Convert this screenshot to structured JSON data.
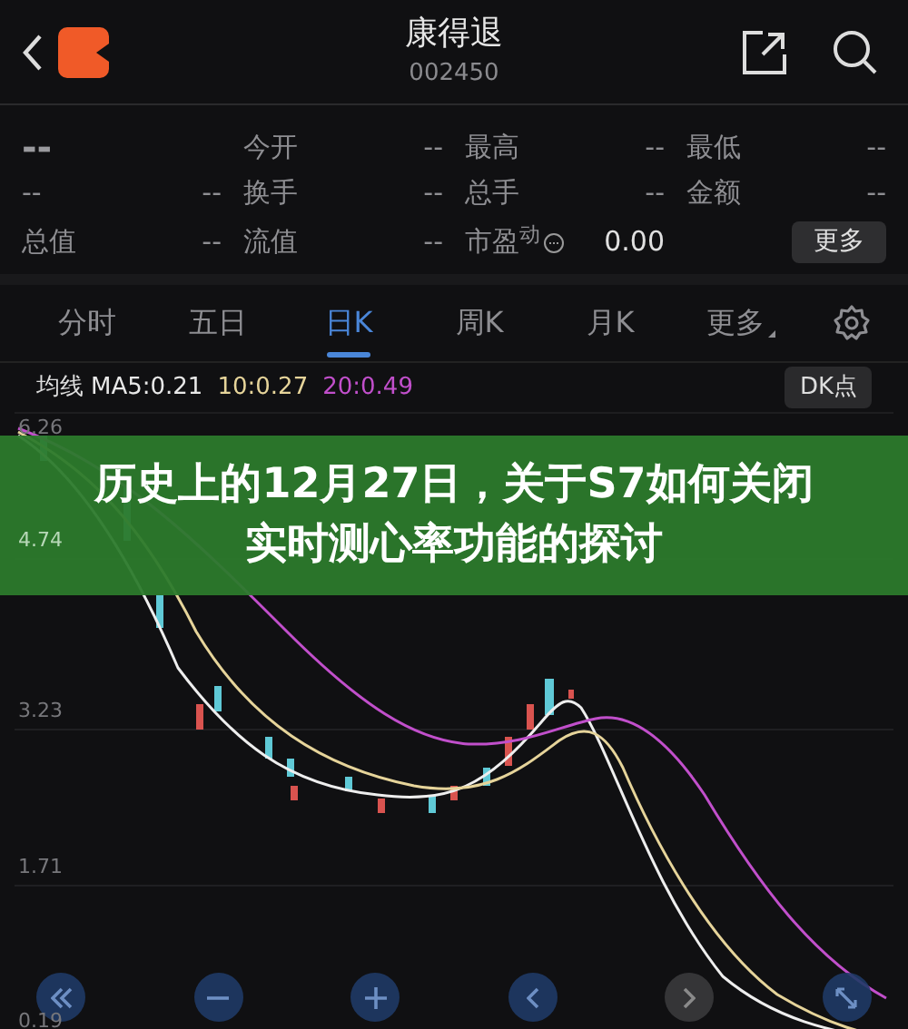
{
  "header": {
    "title": "康得退",
    "code": "002450"
  },
  "quote": {
    "rows": [
      [
        {
          "kind": "price",
          "value": "--"
        },
        {
          "kind": "stat",
          "label": "今开",
          "value": "--"
        },
        {
          "kind": "stat",
          "label": "最高",
          "value": "--"
        },
        {
          "kind": "stat",
          "label": "最低",
          "value": "--"
        }
      ],
      [
        {
          "kind": "stat",
          "label": "--",
          "value": "--"
        },
        {
          "kind": "stat",
          "label": "换手",
          "value": "--"
        },
        {
          "kind": "stat",
          "label": "总手",
          "value": "--"
        },
        {
          "kind": "stat",
          "label": "金额",
          "value": "--"
        }
      ],
      [
        {
          "kind": "stat",
          "label": "总值",
          "value": "--"
        },
        {
          "kind": "stat",
          "label": "流值",
          "value": "--"
        },
        {
          "kind": "stat_info",
          "label": "市盈$^{动}$",
          "value": "0.00"
        },
        {
          "kind": "button",
          "label": "更多"
        }
      ]
    ]
  },
  "tabs": [
    {
      "label": "分时",
      "selected": false
    },
    {
      "label": "五日",
      "selected": false
    },
    {
      "label": "日K",
      "selected": true
    },
    {
      "label": "周K",
      "selected": false
    },
    {
      "label": "月K",
      "selected": false
    },
    {
      "label": "更多",
      "selected": false,
      "kind": "dropdown"
    }
  ],
  "indicators": {
    "label": "均线",
    "items": [
      {
        "text": "MA5:0.21",
        "color": "#e8e8e8"
      },
      {
        "text": "10:0.27",
        "color": "#e6d49a"
      },
      {
        "text": "20:0.49",
        "color": "#c14fcb"
      }
    ],
    "button": "DK点"
  },
  "chart": {
    "axis_labels": [
      "6.26",
      "4.74",
      "3.23",
      "1.71",
      "0.19"
    ]
  },
  "banner": {
    "title": "历史上的12月27日，关于S7如何关闭实时测心率功能的探讨"
  },
  "controls": [
    {
      "kind": "first",
      "disabled": false
    },
    {
      "kind": "zoom_out",
      "disabled": false
    },
    {
      "kind": "zoom_in",
      "disabled": false
    },
    {
      "kind": "prev",
      "disabled": false
    },
    {
      "kind": "next",
      "disabled": true
    },
    {
      "kind": "fullscreen",
      "disabled": false
    }
  ]
}
